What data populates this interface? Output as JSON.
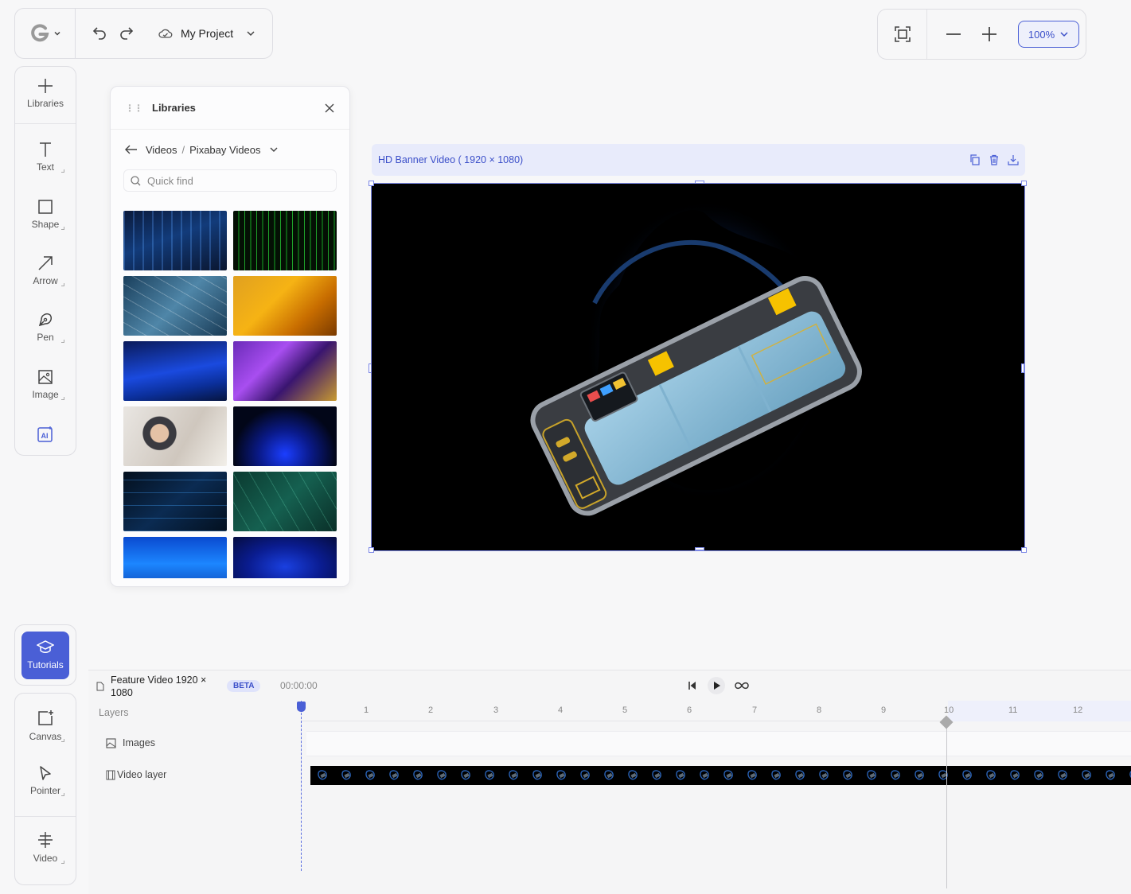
{
  "topbar": {
    "project_name": "My Project",
    "logo_icon": "g-logo-icon",
    "undo_icon": "undo-icon",
    "redo_icon": "redo-icon",
    "cloud_icon": "cloud-icon"
  },
  "zoom": {
    "level": "100%"
  },
  "toolbar": {
    "items": [
      {
        "label": "Libraries",
        "icon": "plus-icon"
      },
      {
        "label": "Text",
        "icon": "text-icon"
      },
      {
        "label": "Shape",
        "icon": "square-icon"
      },
      {
        "label": "Arrow",
        "icon": "arrow-icon"
      },
      {
        "label": "Pen",
        "icon": "pen-icon"
      },
      {
        "label": "Image",
        "icon": "image-icon"
      },
      {
        "label": "",
        "icon": "ai-icon"
      }
    ],
    "tutorials_label": "Tutorials",
    "bottom_items": [
      {
        "label": "Canvas",
        "icon": "canvas-icon"
      },
      {
        "label": "Pointer",
        "icon": "pointer-icon"
      },
      {
        "label": "Video",
        "icon": "video-icon"
      }
    ]
  },
  "libraries": {
    "title": "Libraries",
    "crumb_root": "Videos",
    "crumb_sep": "/",
    "crumb_current": "Pixabay Videos",
    "search_placeholder": "Quick find",
    "thumbnails": [
      {
        "name": "blue-grid-city"
      },
      {
        "name": "green-matrix-code"
      },
      {
        "name": "plexus-network"
      },
      {
        "name": "orange-gradient"
      },
      {
        "name": "blue-waves-lines"
      },
      {
        "name": "purple-geometric"
      },
      {
        "name": "people-tablet"
      },
      {
        "name": "blue-particle-wave"
      },
      {
        "name": "circuit-lines"
      },
      {
        "name": "green-lines"
      },
      {
        "name": "blue-water"
      },
      {
        "name": "blue-abstract"
      }
    ]
  },
  "artboard": {
    "title": "HD Banner  Video ( 1920 × 1080)",
    "actions": [
      "copy-icon",
      "trash-icon",
      "download-icon"
    ]
  },
  "timeline": {
    "title": "Feature Video 1920 × 1080",
    "badge": "BETA",
    "timecode": "00:00:00",
    "layers_label": "Layers",
    "rows": [
      {
        "label": "Images",
        "icon": "image-icon"
      },
      {
        "label": "Video layer",
        "icon": "film-icon"
      }
    ],
    "ruler_ticks": [
      "1",
      "2",
      "3",
      "4",
      "5",
      "6",
      "7",
      "8",
      "9",
      "10",
      "11",
      "12"
    ]
  }
}
